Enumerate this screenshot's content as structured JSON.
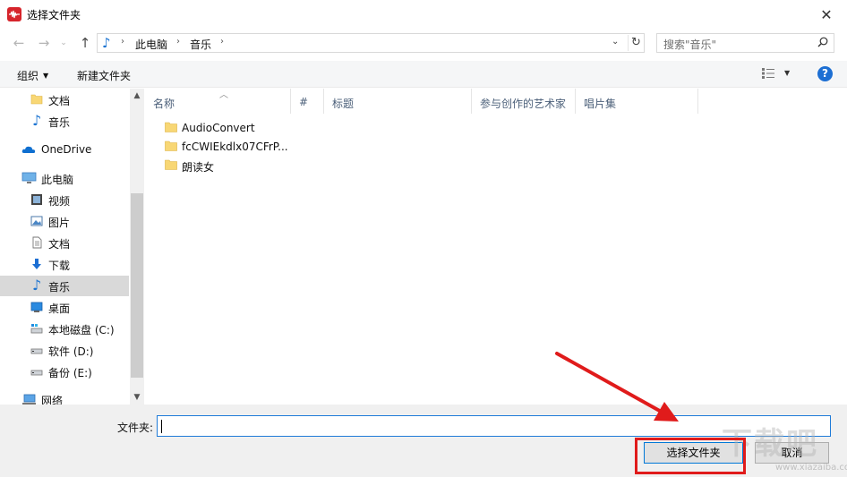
{
  "window": {
    "title": "选择文件夹",
    "close_icon": "close-icon"
  },
  "navigation": {
    "path": [
      "此电脑",
      "音乐"
    ],
    "search_placeholder": "搜索\"音乐\""
  },
  "toolbar": {
    "organize_label": "组织",
    "new_folder_label": "新建文件夹"
  },
  "sidebar": {
    "items": [
      {
        "label": "文档",
        "icon": "folder-icon"
      },
      {
        "label": "音乐",
        "icon": "music-icon"
      },
      {
        "label": "OneDrive",
        "icon": "cloud-icon"
      },
      {
        "label": "此电脑",
        "icon": "computer-icon"
      },
      {
        "label": "视频",
        "icon": "video-icon"
      },
      {
        "label": "图片",
        "icon": "picture-icon"
      },
      {
        "label": "文档",
        "icon": "document-icon"
      },
      {
        "label": "下载",
        "icon": "download-icon"
      },
      {
        "label": "音乐",
        "icon": "music-icon",
        "selected": true
      },
      {
        "label": "桌面",
        "icon": "desktop-icon"
      },
      {
        "label": "本地磁盘 (C:)",
        "icon": "drive-icon"
      },
      {
        "label": "软件 (D:)",
        "icon": "drive-icon"
      },
      {
        "label": "备份 (E:)",
        "icon": "drive-icon"
      },
      {
        "label": "网络",
        "icon": "network-icon"
      }
    ]
  },
  "file_list": {
    "columns": [
      "名称",
      "#",
      "标题",
      "参与创作的艺术家",
      "唱片集"
    ],
    "rows": [
      {
        "name": "AudioConvert"
      },
      {
        "name": "fcCWIEkdlx07CFrP..."
      },
      {
        "name": "朗读女"
      }
    ]
  },
  "footer": {
    "folder_label": "文件夹:",
    "folder_value": "",
    "select_button": "选择文件夹",
    "cancel_button": "取消"
  },
  "annotation": {
    "color": "#e01b1b"
  },
  "watermark": {
    "text": "下载吧",
    "sub": "www.xiazaiba.com"
  }
}
